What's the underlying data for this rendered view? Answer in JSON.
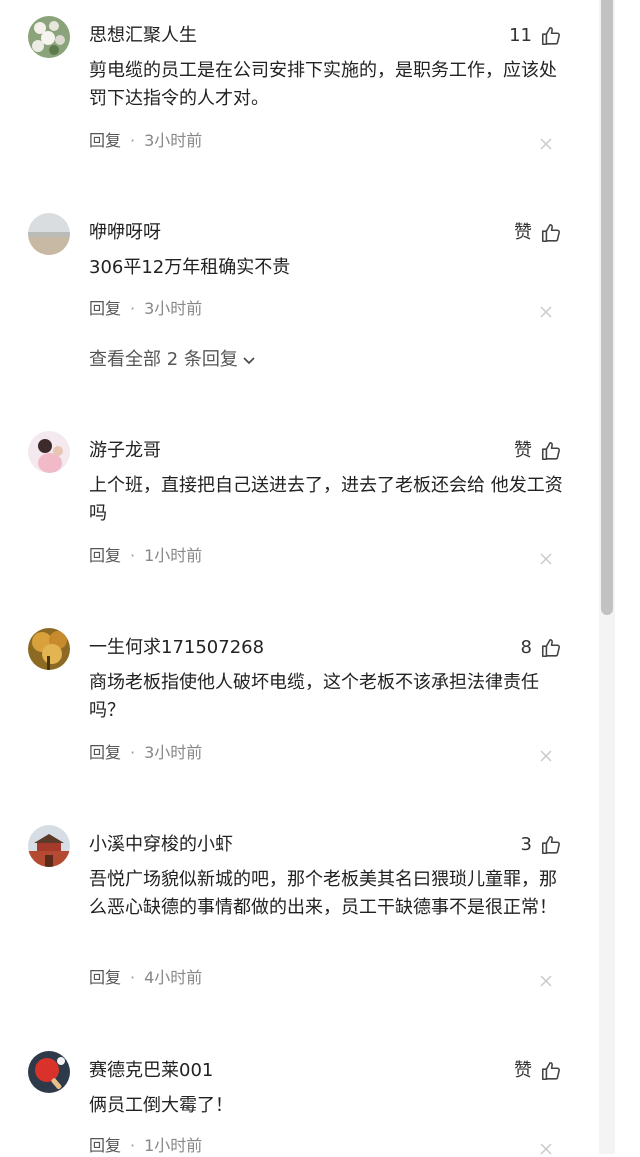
{
  "comments": [
    {
      "username": "思想汇聚人生",
      "like_label": "11",
      "text": "剪电缆的员工是在公司安排下实施的，是职务工作，应该处罚下达指令的人才对。",
      "reply_label": "回复",
      "dot": "·",
      "time": "3小时前",
      "avatar_icon": "avatar-flowers-icon"
    },
    {
      "username": "咿咿呀呀",
      "like_label": "赞",
      "text": "306平12万年租确实不贵",
      "reply_label": "回复",
      "dot": "·",
      "time": "3小时前",
      "view_all_label": "查看全部 2 条回复",
      "avatar_icon": "avatar-landscape-icon"
    },
    {
      "username": "游子龙哥",
      "like_label": "赞",
      "text": "上个班，直接把自己送进去了，进去了老板还会给 他发工资吗",
      "reply_label": "回复",
      "dot": "·",
      "time": "1小时前",
      "avatar_icon": "avatar-person-icon"
    },
    {
      "username": "一生何求171507268",
      "like_label": "8",
      "text": "商场老板指使他人破坏电缆，这个老板不该承担法律责任吗？",
      "reply_label": "回复",
      "dot": "·",
      "time": "3小时前",
      "avatar_icon": "avatar-autumn-tree-icon"
    },
    {
      "username": "小溪中穿梭的小虾",
      "like_label": "3",
      "text": "吾悦广场貌似新城的吧，那个老板美其名曰猥琐儿童罪，那么恶心缺德的事情都做的出来，员工干缺德事不是很正常！",
      "reply_label": "回复",
      "dot": "·",
      "time": "4小时前",
      "avatar_icon": "avatar-palace-icon"
    },
    {
      "username": "赛德克巴莱001",
      "like_label": "赞",
      "text": "俩员工倒大霉了！",
      "reply_label": "回复",
      "dot": "·",
      "time": "1小时前",
      "avatar_icon": "avatar-pingpong-icon"
    }
  ],
  "colors": {
    "text": "#222222",
    "meta": "#888888",
    "scrollbar_thumb": "#c2c2c2"
  }
}
